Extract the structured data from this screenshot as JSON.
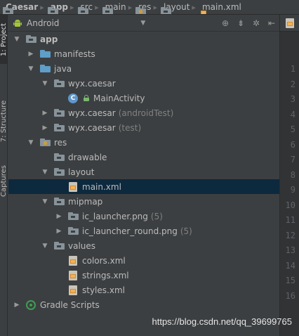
{
  "breadcrumb": [
    {
      "label": "Caesar",
      "icon": "module-folder-icon",
      "bold": true
    },
    {
      "label": "app",
      "icon": "module-folder-icon",
      "bold": true
    },
    {
      "label": "src",
      "icon": "folder-icon",
      "bold": false
    },
    {
      "label": "main",
      "icon": "folder-icon",
      "bold": false
    },
    {
      "label": "res",
      "icon": "res-folder-icon",
      "bold": false
    },
    {
      "label": "layout",
      "icon": "folder-icon",
      "bold": false
    },
    {
      "label": "main.xml",
      "icon": "xml-file-icon",
      "bold": false
    }
  ],
  "side_tabs": {
    "project": "1: Project",
    "structure": "7: Structure",
    "captures": "Captures"
  },
  "view_selector": {
    "label": "Android",
    "icon": "android-icon"
  },
  "toolbar_icons": [
    "locate-icon",
    "collapse-all-icon",
    "settings-icon",
    "hide-icon"
  ],
  "tree": [
    {
      "label": "app",
      "depth": 0,
      "arrow": "expanded",
      "icon": "module-folder",
      "bold": true
    },
    {
      "label": "manifests",
      "depth": 1,
      "arrow": "collapsed",
      "icon": "folder-blue"
    },
    {
      "label": "java",
      "depth": 1,
      "arrow": "expanded",
      "icon": "folder-blue"
    },
    {
      "label": "wyx.caesar",
      "depth": 2,
      "arrow": "expanded",
      "icon": "package"
    },
    {
      "label": "MainActivity",
      "depth": 3,
      "arrow": "none",
      "icon": "class"
    },
    {
      "label": "wyx.caesar",
      "suffix": "(androidTest)",
      "depth": 2,
      "arrow": "collapsed",
      "icon": "package"
    },
    {
      "label": "wyx.caesar",
      "suffix": "(test)",
      "depth": 2,
      "arrow": "collapsed",
      "icon": "package"
    },
    {
      "label": "res",
      "depth": 1,
      "arrow": "expanded",
      "icon": "res-folder"
    },
    {
      "label": "drawable",
      "depth": 2,
      "arrow": "none",
      "icon": "folder"
    },
    {
      "label": "layout",
      "depth": 2,
      "arrow": "expanded",
      "icon": "folder"
    },
    {
      "label": "main.xml",
      "depth": 3,
      "arrow": "none",
      "icon": "xml-file",
      "selected": true
    },
    {
      "label": "mipmap",
      "depth": 2,
      "arrow": "expanded",
      "icon": "folder"
    },
    {
      "label": "ic_launcher.png",
      "suffix": "(5)",
      "depth": 3,
      "arrow": "collapsed",
      "icon": "folder"
    },
    {
      "label": "ic_launcher_round.png",
      "suffix": "(5)",
      "depth": 3,
      "arrow": "collapsed",
      "icon": "folder"
    },
    {
      "label": "values",
      "depth": 2,
      "arrow": "expanded",
      "icon": "folder"
    },
    {
      "label": "colors.xml",
      "depth": 3,
      "arrow": "none",
      "icon": "xml-file"
    },
    {
      "label": "strings.xml",
      "depth": 3,
      "arrow": "none",
      "icon": "xml-file"
    },
    {
      "label": "styles.xml",
      "depth": 3,
      "arrow": "none",
      "icon": "xml-file"
    },
    {
      "label": "Gradle Scripts",
      "depth": 0,
      "arrow": "collapsed",
      "icon": "gradle"
    }
  ],
  "gutter_lines": [
    "1",
    "2",
    "3",
    "4",
    "5",
    "6",
    "7",
    "8",
    "9",
    "10",
    "11",
    "12",
    "13",
    "14",
    "15",
    "16"
  ],
  "watermark": "https://blog.csdn.net/qq_39699765",
  "colors": {
    "background": "#3c3f41",
    "selection": "#0d293e",
    "text": "#bbbbbb",
    "muted": "#808080",
    "folder_blue": "#5e9ec8",
    "class_blue": "#5f97cc",
    "gradle_green": "#3f9d52"
  }
}
